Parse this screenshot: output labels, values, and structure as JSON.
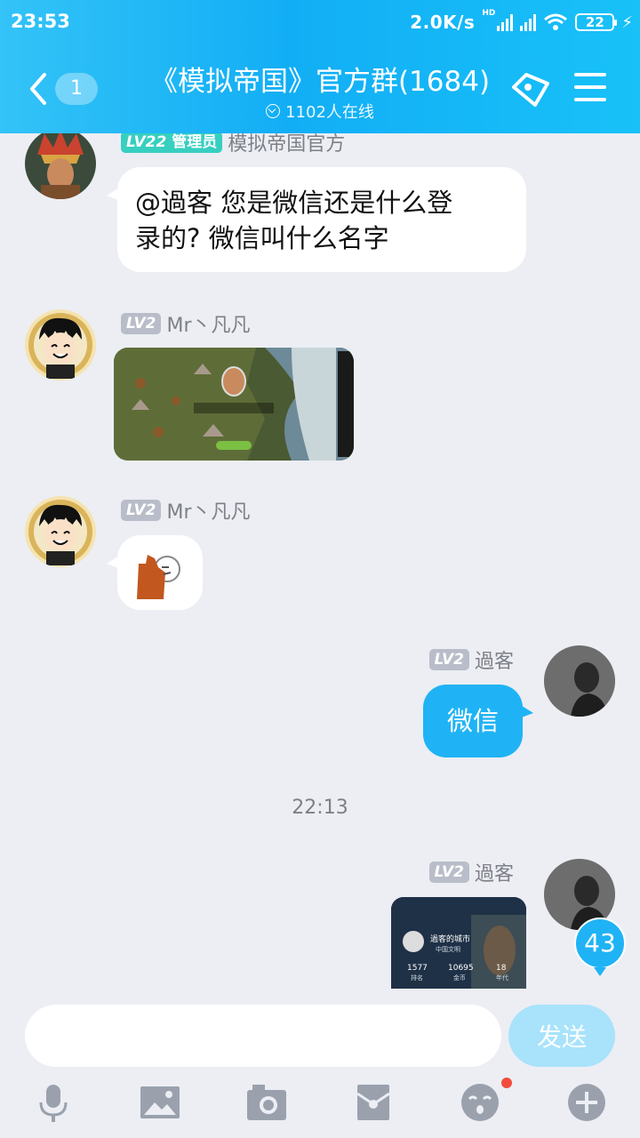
{
  "status": {
    "time": "23:53",
    "speed": "2.0K/s",
    "network": "HD",
    "battery": "22"
  },
  "header": {
    "back_badge": "1",
    "title": "《模拟帝国》官方群(1684)",
    "online": "1102人在线"
  },
  "messages": [
    {
      "sender": "模拟帝国官方",
      "level": "LV22",
      "role": "管理员",
      "text_line1": "@過客 您是微信还是什么登",
      "text_line2": "录的? 微信叫什么名字"
    },
    {
      "sender": "Mr丶凡凡",
      "level": "LV2",
      "type": "image"
    },
    {
      "sender": "Mr丶凡凡",
      "level": "LV2",
      "type": "sticker"
    },
    {
      "sender": "過客",
      "level": "LV2",
      "text": "微信"
    },
    {
      "sender": "過客",
      "level": "LV2",
      "type": "image",
      "card_name": "過客的城市",
      "card_sub": "中国文明",
      "card_stats": [
        "1577",
        "10695",
        "18"
      ],
      "card_stat_labels": [
        "排名",
        "金币",
        "年代"
      ]
    }
  ],
  "timestamp": "22:13",
  "unread_count": "43",
  "composer": {
    "placeholder": "",
    "send_label": "发送"
  },
  "toolbar_icons": [
    "mic-icon",
    "image-icon",
    "camera-icon",
    "red-packet-icon",
    "emoji-icon",
    "plus-icon"
  ],
  "colors": {
    "brand_blue": "#1fb3f5",
    "admin_badge": "#37cfc0",
    "level_badge": "#b9bdc9"
  }
}
